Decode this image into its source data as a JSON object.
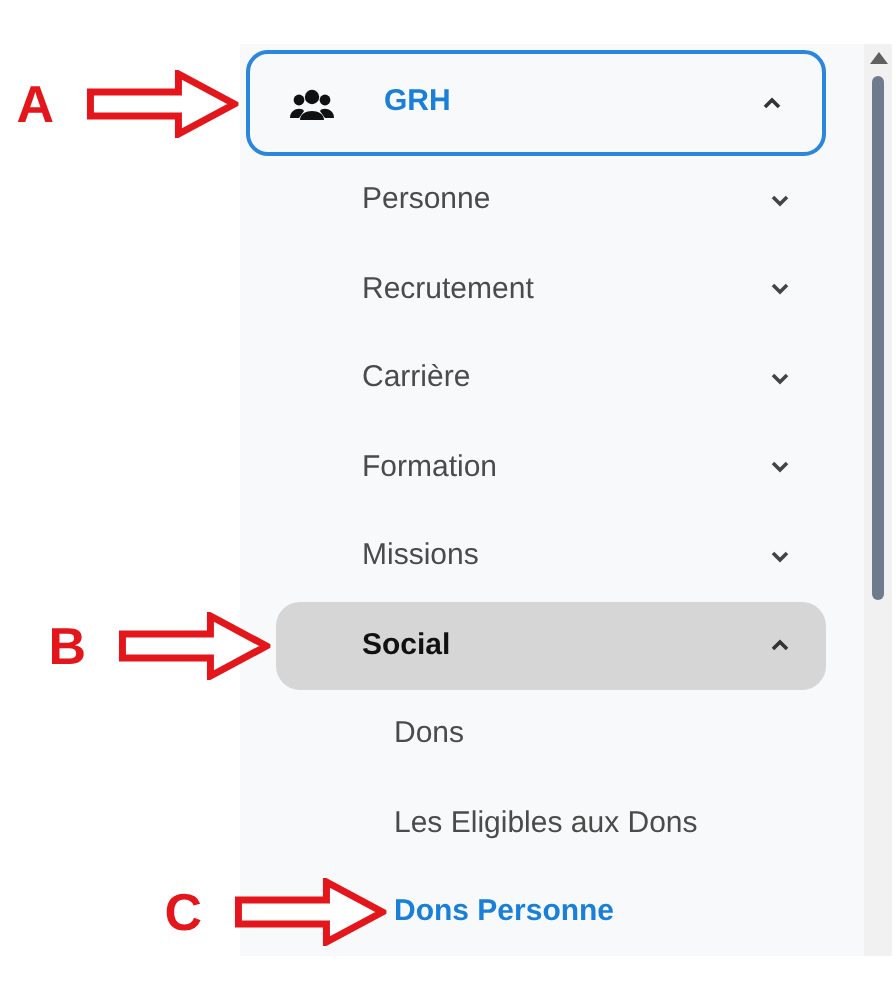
{
  "menu": {
    "label": "GRH",
    "expanded": true,
    "annotation": "A",
    "items": [
      {
        "label": "Personne",
        "expanded": false,
        "selected": false
      },
      {
        "label": "Recrutement",
        "expanded": false,
        "selected": false
      },
      {
        "label": "Carrière",
        "expanded": false,
        "selected": false
      },
      {
        "label": "Formation",
        "expanded": false,
        "selected": false
      },
      {
        "label": "Missions",
        "expanded": false,
        "selected": false
      },
      {
        "label": "Social",
        "expanded": true,
        "selected": true,
        "annotation": "B",
        "children": [
          {
            "label": "Dons",
            "selected": false
          },
          {
            "label": "Les Eligibles aux Dons",
            "selected": false
          },
          {
            "label": "Dons Personne",
            "selected": true,
            "annotation": "C"
          }
        ]
      }
    ]
  }
}
